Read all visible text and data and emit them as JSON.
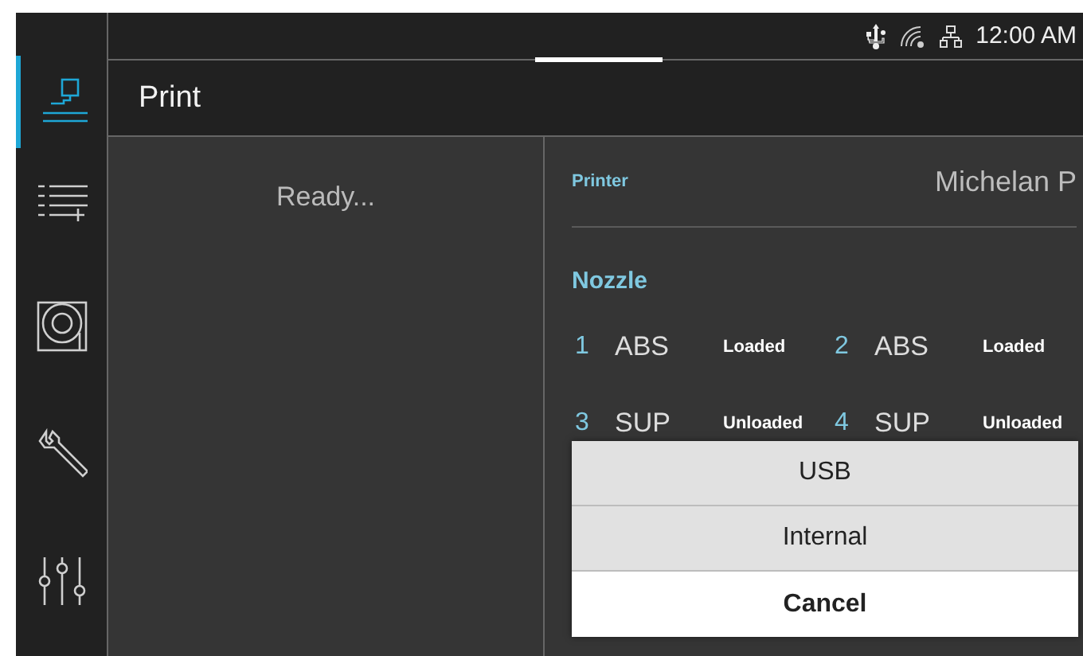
{
  "status_bar": {
    "time": "12:00 AM"
  },
  "sidebar": {
    "items": [
      {
        "kind": "print",
        "selected": true
      },
      {
        "kind": "queue",
        "selected": false
      },
      {
        "kind": "storage",
        "selected": false
      },
      {
        "kind": "tools",
        "selected": false
      },
      {
        "kind": "settings",
        "selected": false
      }
    ]
  },
  "header": {
    "title": "Print"
  },
  "status": "Ready...",
  "printer": {
    "label": "Printer",
    "value": "Michelan P"
  },
  "nozzle": {
    "title": "Nozzle",
    "slots": [
      {
        "number": "1",
        "material": "ABS",
        "state": "Loaded"
      },
      {
        "number": "2",
        "material": "ABS",
        "state": "Loaded"
      },
      {
        "number": "3",
        "material": "SUP",
        "state": "Unloaded"
      },
      {
        "number": "4",
        "material": "SUP",
        "state": "Unloaded"
      }
    ]
  },
  "dialog": {
    "options": [
      {
        "label": "USB",
        "kind": "option"
      },
      {
        "label": "Internal",
        "kind": "option"
      },
      {
        "label": "Cancel",
        "kind": "cancel"
      }
    ]
  }
}
